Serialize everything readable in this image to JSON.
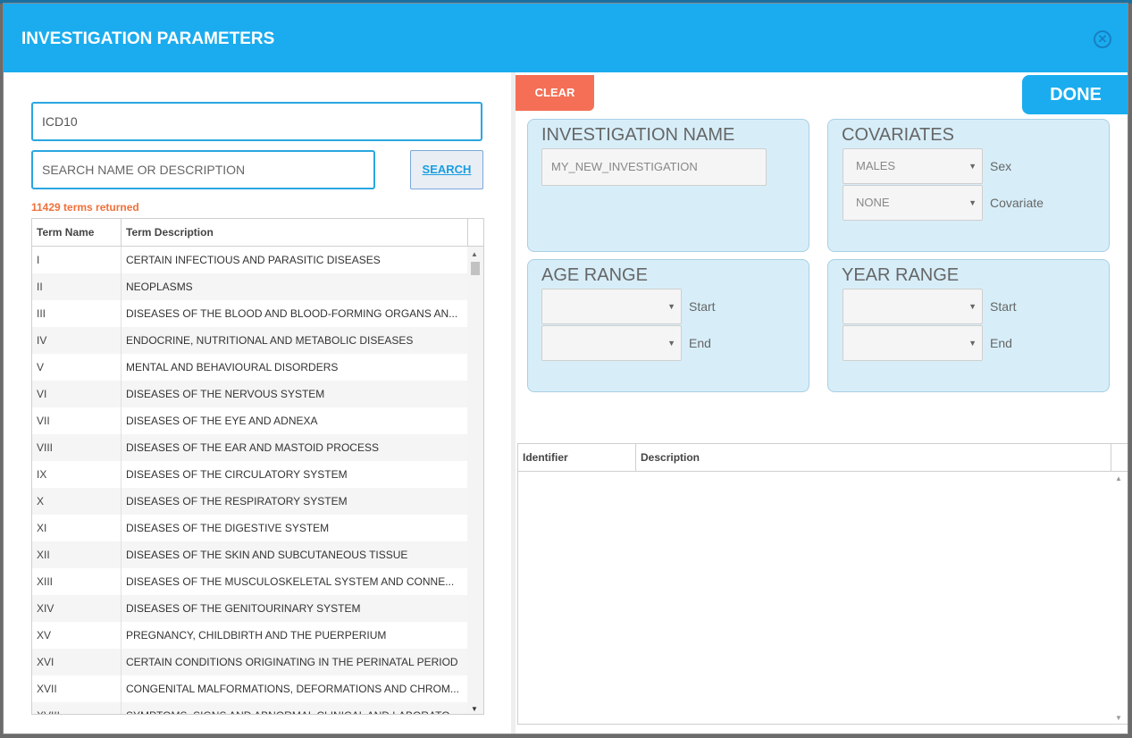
{
  "modal": {
    "title": "INVESTIGATION PARAMETERS",
    "close_icon": "close-circle-icon"
  },
  "left": {
    "vocabulary_value": "ICD10",
    "search_placeholder": "SEARCH NAME OR DESCRIPTION",
    "search_label": "SEARCH",
    "terms_count": "11429 terms returned",
    "columns": [
      "Term Name",
      "Term Description"
    ],
    "rows": [
      {
        "name": "I",
        "desc": "CERTAIN INFECTIOUS AND PARASITIC DISEASES"
      },
      {
        "name": "II",
        "desc": "NEOPLASMS"
      },
      {
        "name": "III",
        "desc": "DISEASES OF THE BLOOD AND BLOOD-FORMING ORGANS AN..."
      },
      {
        "name": "IV",
        "desc": "ENDOCRINE, NUTRITIONAL AND METABOLIC DISEASES"
      },
      {
        "name": "V",
        "desc": "MENTAL AND BEHAVIOURAL DISORDERS"
      },
      {
        "name": "VI",
        "desc": "DISEASES OF THE NERVOUS SYSTEM"
      },
      {
        "name": "VII",
        "desc": "DISEASES OF THE EYE AND ADNEXA"
      },
      {
        "name": "VIII",
        "desc": "DISEASES OF THE EAR AND MASTOID PROCESS"
      },
      {
        "name": "IX",
        "desc": "DISEASES OF THE CIRCULATORY SYSTEM"
      },
      {
        "name": "X",
        "desc": "DISEASES OF THE RESPIRATORY SYSTEM"
      },
      {
        "name": "XI",
        "desc": "DISEASES OF THE DIGESTIVE SYSTEM"
      },
      {
        "name": "XII",
        "desc": "DISEASES OF THE SKIN AND SUBCUTANEOUS TISSUE"
      },
      {
        "name": "XIII",
        "desc": "DISEASES OF THE MUSCULOSKELETAL SYSTEM AND CONNE..."
      },
      {
        "name": "XIV",
        "desc": "DISEASES OF THE GENITOURINARY SYSTEM"
      },
      {
        "name": "XV",
        "desc": "PREGNANCY, CHILDBIRTH AND THE PUERPERIUM"
      },
      {
        "name": "XVI",
        "desc": "CERTAIN CONDITIONS ORIGINATING IN THE PERINATAL PERIOD"
      },
      {
        "name": "XVII",
        "desc": "CONGENITAL MALFORMATIONS, DEFORMATIONS AND CHROM..."
      },
      {
        "name": "XVIII",
        "desc": "SYMPTOMS, SIGNS AND ABNORMAL CLINICAL AND LABORATO..."
      }
    ]
  },
  "right": {
    "clear_label": "CLEAR",
    "done_label": "DONE",
    "investigation_name": {
      "title": "INVESTIGATION NAME",
      "placeholder": "MY_NEW_INVESTIGATION"
    },
    "covariates": {
      "title": "COVARIATES",
      "sex_value": "MALES",
      "sex_label": "Sex",
      "covariate_value": "NONE",
      "covariate_label": "Covariate"
    },
    "age_range": {
      "title": "AGE RANGE",
      "start_value": "",
      "start_label": "Start",
      "end_value": "",
      "end_label": "End"
    },
    "year_range": {
      "title": "YEAR RANGE",
      "start_value": "",
      "start_label": "Start",
      "end_value": "",
      "end_label": "End"
    },
    "selected_grid": {
      "columns": [
        "Identifier",
        "Description"
      ]
    }
  },
  "colors": {
    "header": "#1aacef",
    "clear": "#f46f55",
    "terms_count": "#f0703a",
    "panel": "#d7eef9"
  }
}
